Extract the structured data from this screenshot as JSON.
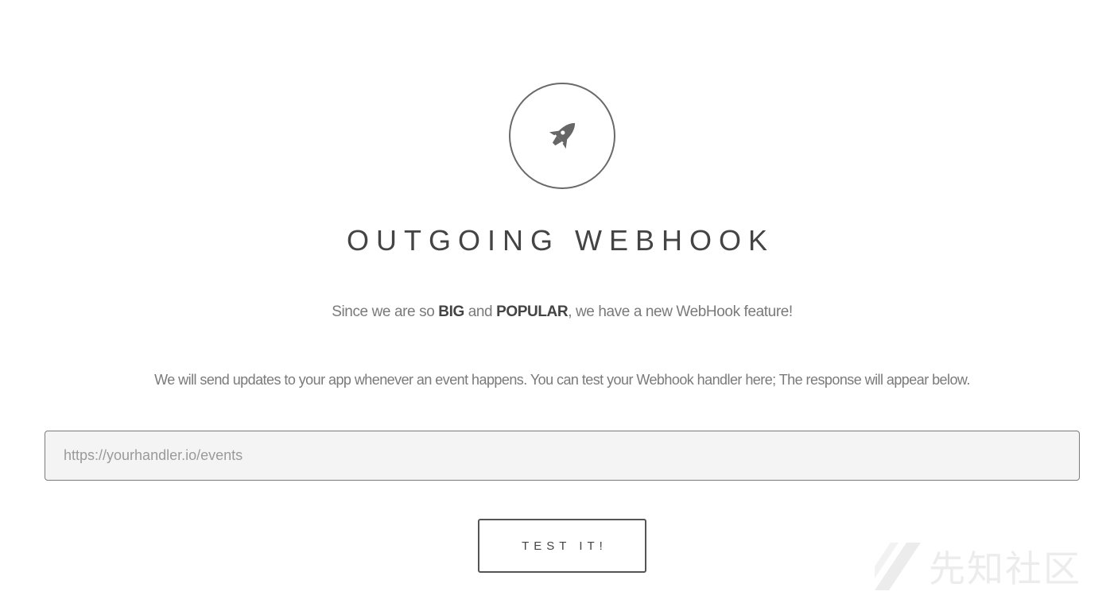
{
  "header": {
    "icon": "rocket-icon",
    "title": "OUTGOING WEBHOOK"
  },
  "intro": {
    "part1": "Since we are so ",
    "bold1": "BIG",
    "part2": " and ",
    "bold2": "POPULAR",
    "part3": ", we have a new WebHook feature!"
  },
  "description": "We will send updates to your app whenever an event happens. You can test your Webhook handler here; The response will appear below.",
  "form": {
    "url_placeholder": "https://yourhandler.io/events",
    "url_value": "",
    "submit_label": "TEST IT!"
  },
  "watermark": {
    "text": "先知社区"
  },
  "colors": {
    "text": "#555555",
    "input_background": "#f4f4f4",
    "border": "#6a6a6a"
  }
}
